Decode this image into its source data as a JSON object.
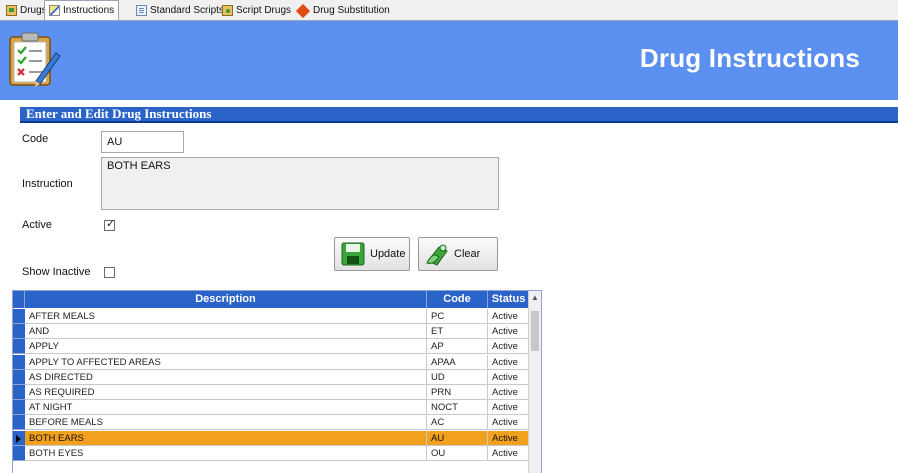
{
  "tabs": [
    {
      "label": "Drugs",
      "icon": "drugs-icon"
    },
    {
      "label": "Instructions",
      "icon": "instructions-icon",
      "active": true
    },
    {
      "label": "Standard Scripts",
      "icon": "standard-scripts-icon"
    },
    {
      "label": "Script Drugs",
      "icon": "script-drugs-icon"
    },
    {
      "label": "Drug Substitution",
      "icon": "drug-substitution-icon"
    }
  ],
  "header": {
    "title": "Drug Instructions",
    "icon": "clipboard-checklist-icon",
    "color": "#5b8ff0"
  },
  "section": {
    "title": "Enter and Edit Drug Instructions",
    "color": "#2b64c8"
  },
  "form": {
    "code_label": "Code",
    "code_value": "AU",
    "instruction_label": "Instruction",
    "instruction_value": "BOTH EARS",
    "active_label": "Active",
    "active_checked": true,
    "show_inactive_label": "Show Inactive",
    "show_inactive_checked": false
  },
  "buttons": {
    "update": "Update",
    "clear": "Clear"
  },
  "grid": {
    "columns": [
      "Description",
      "Code",
      "Status"
    ],
    "rows": [
      [
        "AFTER MEALS",
        "PC",
        "Active"
      ],
      [
        "AND",
        "ET",
        "Active"
      ],
      [
        "APPLY",
        "AP",
        "Active"
      ],
      [
        "APPLY TO AFFECTED AREAS",
        "APAA",
        "Active"
      ],
      [
        "AS DIRECTED",
        "UD",
        "Active"
      ],
      [
        "AS REQUIRED",
        "PRN",
        "Active"
      ],
      [
        "AT NIGHT",
        "NOCT",
        "Active"
      ],
      [
        "BEFORE MEALS",
        "AC",
        "Active"
      ],
      [
        "BOTH EARS",
        "AU",
        "Active"
      ],
      [
        "BOTH EYES",
        "OU",
        "Active"
      ]
    ],
    "selected_row": 8,
    "selected_color": "#f2a11f"
  }
}
